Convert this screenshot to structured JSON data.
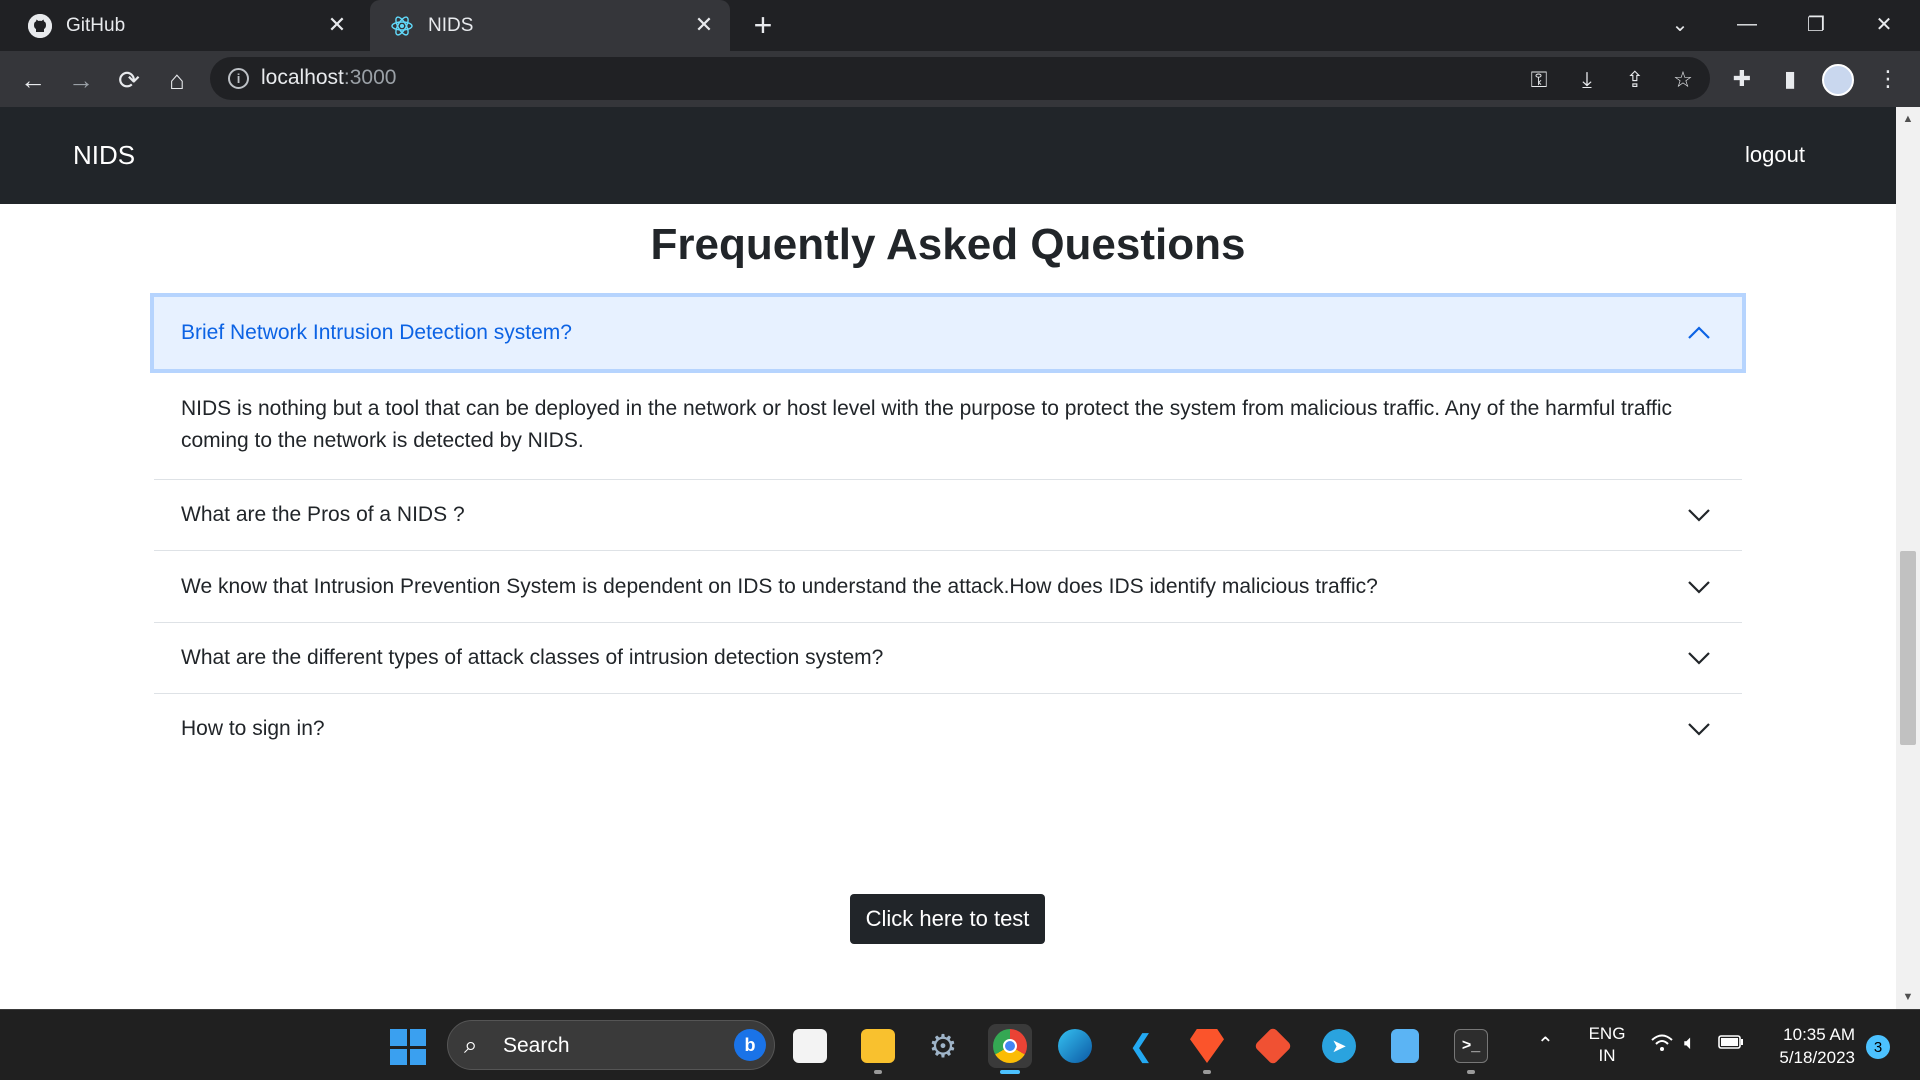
{
  "browser": {
    "tabs": [
      {
        "title": "GitHub",
        "icon": "github-icon"
      },
      {
        "title": "NIDS",
        "icon": "react-icon",
        "active": true
      }
    ],
    "url_host": "localhost",
    "url_port": ":3000"
  },
  "navbar": {
    "brand": "NIDS",
    "logout": "logout"
  },
  "faq": {
    "title": "Frequently Asked Questions",
    "items": [
      {
        "question": "Brief Network Intrusion Detection system?",
        "answer": "NIDS is nothing but a tool that can be deployed in the network or host level with the purpose to protect the system from malicious traffic. Any of the harmful traffic coming to the network is detected by NIDS.",
        "expanded": true
      },
      {
        "question": "What are the Pros of a NIDS ?",
        "expanded": false
      },
      {
        "question": "We know that Intrusion Prevention System is dependent on IDS to understand the attack.How does IDS identify malicious traffic?",
        "expanded": false
      },
      {
        "question": "What are the different types of attack classes of intrusion detection system?",
        "expanded": false
      },
      {
        "question": "How to sign in?",
        "expanded": false
      }
    ]
  },
  "test_button": "Click here to test",
  "taskbar": {
    "search_label": "Search",
    "language_line1": "ENG",
    "language_line2": "IN",
    "time": "10:35 AM",
    "date": "5/18/2023",
    "notification_count": "3"
  },
  "colors": {
    "navbar_bg": "#212529",
    "accordion_active_bg": "#e7f1ff",
    "accordion_active_text": "#0c63e4",
    "accordion_focus_border": "#b6d4fe",
    "button_bg": "#212529"
  }
}
